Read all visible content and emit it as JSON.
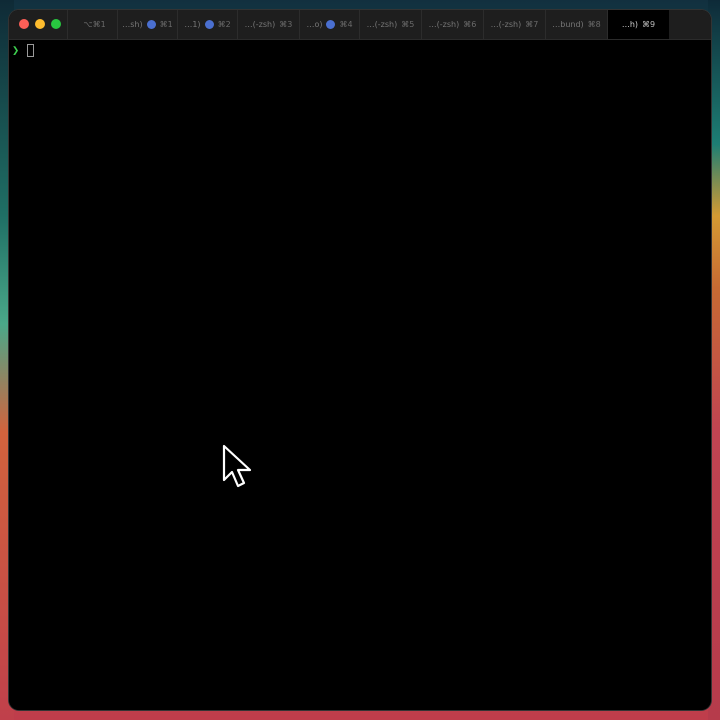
{
  "terminal": {
    "tabs": [
      {
        "label": "",
        "shortcut": "⌥⌘1",
        "dot": false,
        "active": false
      },
      {
        "label": "…sh)",
        "shortcut": "⌘1",
        "dot": true,
        "active": false
      },
      {
        "label": "…1)",
        "shortcut": "⌘2",
        "dot": true,
        "active": false
      },
      {
        "label": "…(-zsh)",
        "shortcut": "⌘3",
        "dot": false,
        "active": false
      },
      {
        "label": "…o)",
        "shortcut": "⌘4",
        "dot": true,
        "active": false
      },
      {
        "label": "…(-zsh)",
        "shortcut": "⌘5",
        "dot": false,
        "active": false
      },
      {
        "label": "…(-zsh)",
        "shortcut": "⌘6",
        "dot": false,
        "active": false
      },
      {
        "label": "…(-zsh)",
        "shortcut": "⌘7",
        "dot": false,
        "active": false
      },
      {
        "label": "…bund)",
        "shortcut": "⌘8",
        "dot": false,
        "active": false
      },
      {
        "label": "…h)",
        "shortcut": "⌘9",
        "dot": false,
        "active": true
      }
    ],
    "prompt_symbol": "❯",
    "colors": {
      "background": "#000000",
      "tab_bar": "#1e1e1e",
      "prompt": "#3ecf4f",
      "tab_dot": "#4a6fd0",
      "close": "#fe5f57",
      "minimize": "#febc2e",
      "maximize": "#28c840"
    },
    "icons": {
      "pointer": "mouse-pointer-icon"
    }
  }
}
